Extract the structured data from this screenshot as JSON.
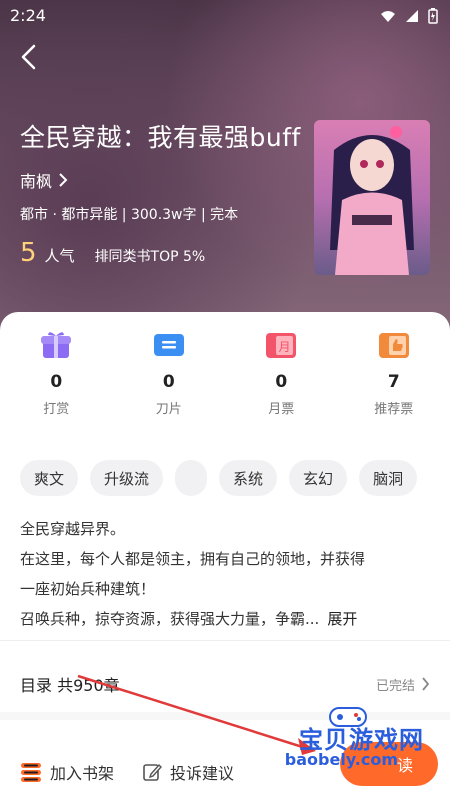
{
  "status": {
    "time": "2:24"
  },
  "book": {
    "title": "全民穿越：我有最强buff",
    "author": "南枫",
    "meta": "都市 · 都市异能 | 300.3w字 | 完本",
    "popularity": "5",
    "popularity_label": "人气",
    "rank": "排同类书TOP 5%"
  },
  "stats": [
    {
      "value": "0",
      "label": "打赏",
      "icon": "gift-icon",
      "color": "#8b6cf2"
    },
    {
      "value": "0",
      "label": "刀片",
      "icon": "ticket-icon",
      "color": "#3c8ff2"
    },
    {
      "value": "0",
      "label": "月票",
      "icon": "month-ticket-icon",
      "color": "#f2546a"
    },
    {
      "value": "7",
      "label": "推荐票",
      "icon": "thumbs-up-icon",
      "color": "#f28a3c"
    }
  ],
  "tags": [
    "爽文",
    "升级流",
    "",
    "系统",
    "玄幻",
    "脑洞"
  ],
  "description": {
    "line1": "全民穿越异界。",
    "line2": "在这里，每个人都是领主，拥有自己的领地，并获得",
    "line3": "一座初始兵种建筑！",
    "line4": "召唤兵种，掠夺资源，获得强大力量，争霸...",
    "expand": "展开"
  },
  "toc": {
    "label": "目录 共950章",
    "status": "已完结"
  },
  "bottom": {
    "shelf": "加入书架",
    "report": "投诉建议",
    "read": "读"
  },
  "watermark": {
    "line1": "宝贝游戏网",
    "line2": "baobely.com"
  },
  "colors": {
    "accent": "#ff6a2a",
    "annotation": "#e03a3a"
  }
}
